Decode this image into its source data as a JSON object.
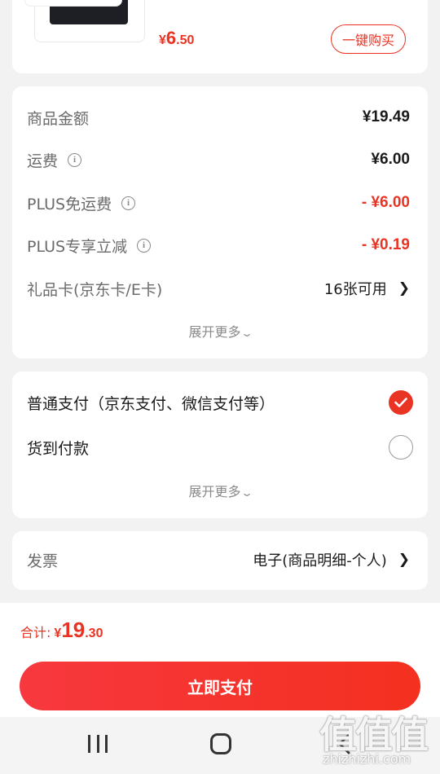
{
  "product": {
    "price_currency": "¥",
    "price_int": "6",
    "price_dec": ".50",
    "buy_now_label": "一键购买"
  },
  "summary": {
    "goods_amount_label": "商品金额",
    "goods_amount_value": "¥19.49",
    "shipping_label": "运费",
    "shipping_value": "¥6.00",
    "plus_free_shipping_label": "PLUS免运费",
    "plus_free_shipping_value": "- ¥6.00",
    "plus_discount_label": "PLUS专享立减",
    "plus_discount_value": "- ¥0.19",
    "gift_card_label": "礼品卡(京东卡/E卡)",
    "gift_card_value": "16张可用",
    "expand_more": "展开更多"
  },
  "payment": {
    "normal_pay_label": "普通支付（京东支付、微信支付等）",
    "cod_label": "货到付款",
    "expand_more": "展开更多",
    "selected": "normal"
  },
  "invoice": {
    "label": "发票",
    "value": "电子(商品明细-个人)"
  },
  "footer": {
    "total_label": "合计:",
    "total_currency": "¥",
    "total_int": "19",
    "total_dec": ".30",
    "pay_button": "立即支付"
  },
  "watermark": {
    "logo_text": "值值值",
    "url": "zhizhizhi.com"
  },
  "colors": {
    "accent": "#e93323",
    "background": "#f2f2f2"
  }
}
